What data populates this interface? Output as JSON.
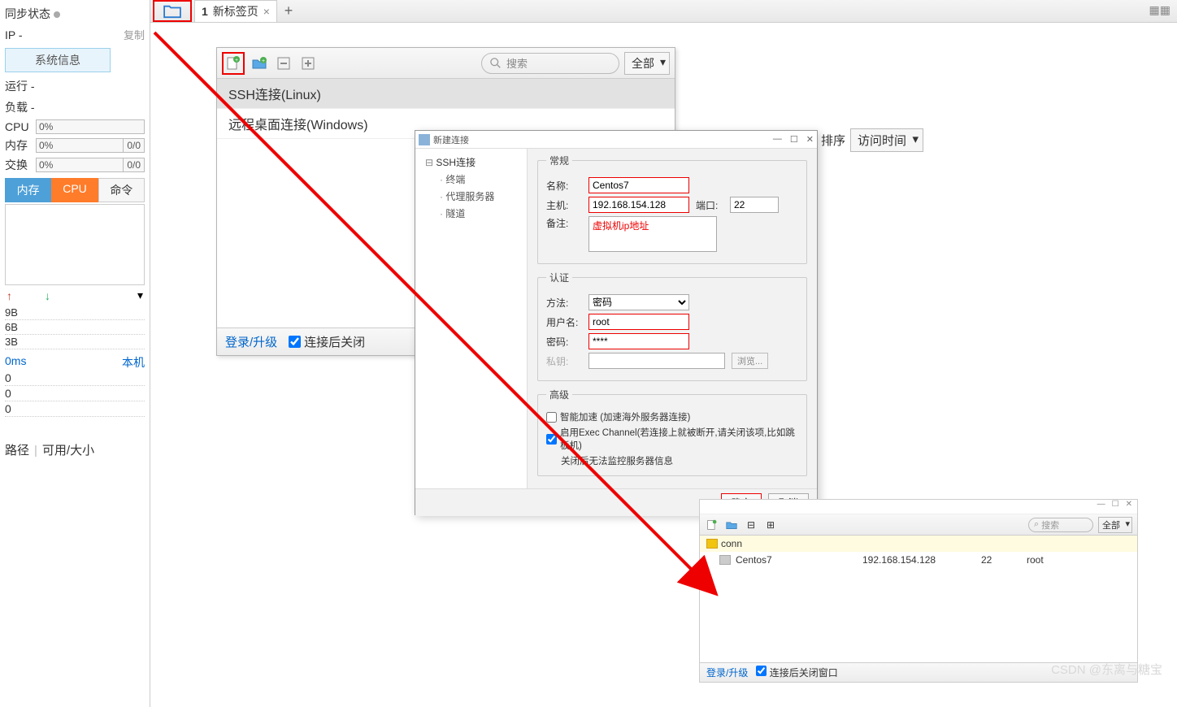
{
  "tabbar": {
    "tab_num": "1",
    "tab_label": "新标签页"
  },
  "sidebar": {
    "sync_label": "同步状态",
    "ip_label": "IP  -",
    "copy": "复制",
    "sysinfo": "系统信息",
    "run": "运行 -",
    "load": "负载 -",
    "cpu_lbl": "CPU",
    "cpu_val": "0%",
    "mem_lbl": "内存",
    "mem_val": "0%",
    "mem_r": "0/0",
    "swap_lbl": "交换",
    "swap_val": "0%",
    "swap_r": "0/0",
    "tab_mem": "内存",
    "tab_cpu": "CPU",
    "tab_cmd": "命令",
    "net_rows": [
      "9B",
      "6B",
      "3B"
    ],
    "ms": "0ms",
    "local": "本机",
    "zeros": [
      "0",
      "0",
      "0"
    ],
    "path_lbl": "路径",
    "avail_lbl": "可用/大小"
  },
  "sesspanel": {
    "search_ph": "搜索",
    "filter": "全部",
    "mi_ssh": "SSH连接(Linux)",
    "mi_rdp": "远程桌面连接(Windows)",
    "login": "登录/升级",
    "close_after": "连接后关闭"
  },
  "sortdd": {
    "lbl": "排序",
    "val": "访问时间"
  },
  "dlg": {
    "title": "新建连接",
    "tree_root": "SSH连接",
    "tree_term": "终端",
    "tree_proxy": "代理服务器",
    "tree_tunnel": "隧道",
    "grp_general": "常规",
    "lbl_name": "名称:",
    "val_name": "Centos7",
    "lbl_host": "主机:",
    "val_host": "192.168.154.128",
    "lbl_port": "端口:",
    "val_port": "22",
    "lbl_note": "备注:",
    "val_note": "虚拟机ip地址",
    "grp_auth": "认证",
    "lbl_method": "方法:",
    "val_method": "密码",
    "lbl_user": "用户名:",
    "val_user": "root",
    "lbl_pass": "密码:",
    "val_pass": "****",
    "lbl_key": "私钥:",
    "browse": "浏览...",
    "grp_adv": "高级",
    "adv_accel": "智能加速 (加速海外服务器连接)",
    "adv_exec": "启用Exec Channel(若连接上就被断开,请关闭该项,比如跳板机)",
    "adv_note": "关闭后无法监控服务器信息",
    "ok": "确定",
    "cancel": "取消"
  },
  "connlist": {
    "search_ph": "搜索",
    "filter": "全部",
    "folder": "conn",
    "item_name": "Centos7",
    "item_host": "192.168.154.128",
    "item_port": "22",
    "item_user": "root",
    "login": "登录/升级",
    "close_after": "连接后关闭窗口"
  },
  "watermark": "CSDN @东离与糖宝"
}
